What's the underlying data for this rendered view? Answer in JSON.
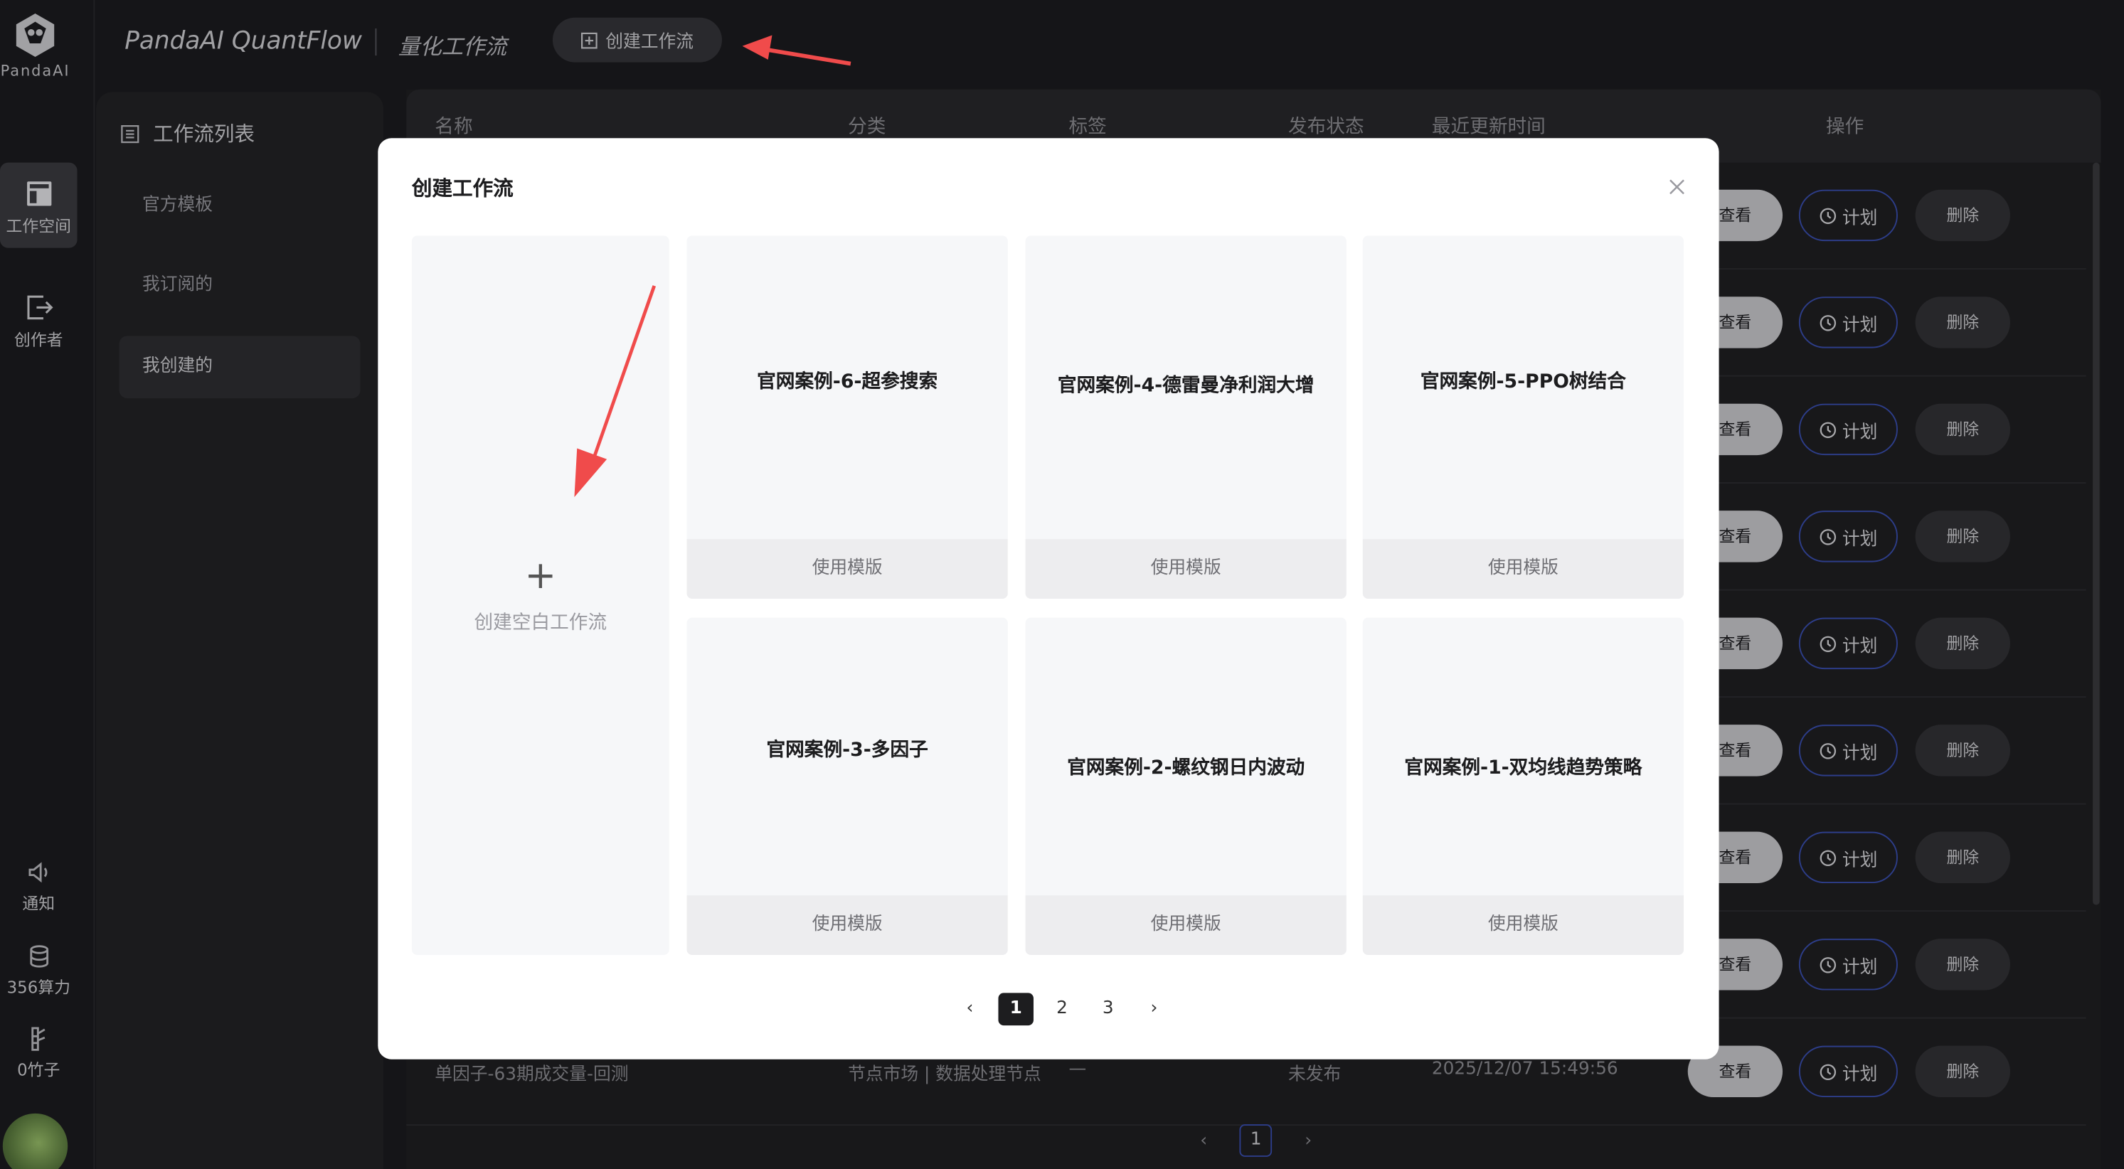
{
  "brand": {
    "logo_text": "PandaAI"
  },
  "header": {
    "title": "PandaAI QuantFlow",
    "subtitle": "量化工作流",
    "create_label": "创建工作流"
  },
  "nav": {
    "workspace": "工作空间",
    "creator": "创作者",
    "notify": "通知",
    "compute": "356算力",
    "bamboo": "0竹子"
  },
  "panel": {
    "title": "工作流列表",
    "items": [
      "官方模板",
      "我订阅的",
      "我创建的"
    ]
  },
  "table": {
    "headers": [
      "名称",
      "分类",
      "标签",
      "发布状态",
      "最近更新时间",
      "操作"
    ],
    "actions": {
      "view": "查看",
      "plan": "计划",
      "delete": "删除"
    },
    "last_row": {
      "name": "单因子-63期成交量-回测",
      "category": "节点市场 | 数据处理节点",
      "tag": "—",
      "status": "未发布",
      "updated": "2025/12/07 15:49:56"
    },
    "pager": {
      "current": "1"
    }
  },
  "modal": {
    "title": "创建工作流",
    "blank_label": "创建空白工作流",
    "use_label": "使用模版",
    "templates": [
      "官网案例-6-超参搜索",
      "官网案例-4-德雷曼净利润大增",
      "官网案例-5-PPO树结合",
      "官网案例-3-多因子",
      "官网案例-2-螺纹钢日内波动",
      "官网案例-1-双均线趋势策略"
    ],
    "pages": [
      "1",
      "2",
      "3"
    ]
  },
  "colors": {
    "accent_arrow": "#f04b4b",
    "plan_border": "#3a4fb0",
    "bg": "#1c1c1f"
  }
}
